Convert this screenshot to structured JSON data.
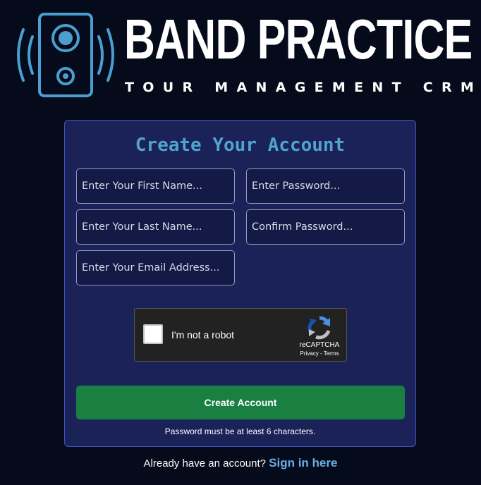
{
  "logo": {
    "title": "BAND PRACTICE",
    "subtitle": "TOUR MANAGEMENT CRM",
    "icon": "speaker-icon"
  },
  "form": {
    "title": "Create Your Account",
    "first_name_placeholder": "Enter Your First Name...",
    "last_name_placeholder": "Enter Your Last Name...",
    "email_placeholder": "Enter Your Email Address...",
    "password_placeholder": "Enter Password...",
    "confirm_placeholder": "Confirm Password...",
    "captcha": {
      "label": "I'm not a robot",
      "brand": "reCAPTCHA",
      "privacy": "Privacy",
      "separator": " - ",
      "terms": "Terms",
      "icon": "recaptcha-icon"
    },
    "submit_label": "Create Account",
    "password_hint": "Password must be at least 6 characters."
  },
  "footer": {
    "prompt": "Already have an account?",
    "link": "Sign in here"
  },
  "colors": {
    "background": "#050b1a",
    "card": "#1b2257",
    "card_border": "#3b57c2",
    "accent": "#4ea4cc",
    "button": "#198042",
    "link": "#6aaee6"
  }
}
